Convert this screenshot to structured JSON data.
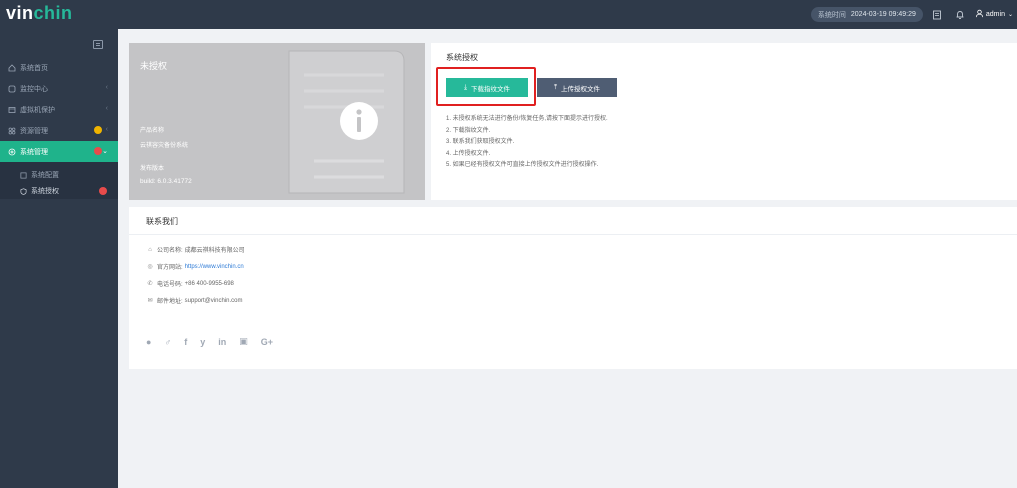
{
  "header": {
    "logo_prefix": "vin",
    "logo_suffix": "chin",
    "time_label": "系统时间",
    "time_value": "2024-03-19 09:49:29",
    "username": "admin"
  },
  "sidebar": {
    "items": [
      {
        "label": "系统首页",
        "icon": "home-icon"
      },
      {
        "label": "监控中心",
        "icon": "monitor-icon"
      },
      {
        "label": "虚拟机保护",
        "icon": "vm-icon"
      },
      {
        "label": "资源管理",
        "icon": "grid-icon"
      },
      {
        "label": "系统管理",
        "icon": "gear-icon"
      }
    ],
    "sub_items": [
      {
        "label": "系统配置",
        "icon": "config-icon"
      },
      {
        "label": "系统授权",
        "icon": "shield-icon"
      }
    ]
  },
  "license_card": {
    "status": "未授权",
    "product_label": "产品名称",
    "product_value": "云祺容灾备份系统",
    "version_label": "发布版本",
    "version_value": "build: 6.0.3.41772"
  },
  "auth_panel": {
    "title": "系统授权",
    "download_btn": "下载指纹文件",
    "upload_btn": "上传授权文件",
    "steps": [
      "1. 未授权系统无法进行备份/恢复任务,请按下面提示进行授权.",
      "2. 下载指纹文件.",
      "3. 联系我们获取授权文件.",
      "4. 上传授权文件.",
      "5. 如果已经有授权文件可直接上传授权文件进行授权操作."
    ]
  },
  "contact": {
    "title": "联系我们",
    "company_label": "公司名称:",
    "company_value": "成都云祺科技有限公司",
    "website_label": "官方网站:",
    "website_value": "https://www.vinchin.cn",
    "phone_label": "电话号码:",
    "phone_value": "+86 400-9955-698",
    "email_label": "邮件地址:",
    "email_value": "support@vinchin.com",
    "social": [
      {
        "icon": "wechat-icon",
        "glyph": "●"
      },
      {
        "icon": "weibo-icon",
        "glyph": "♂"
      },
      {
        "icon": "facebook-icon",
        "glyph": "f"
      },
      {
        "icon": "twitter-icon",
        "glyph": "y"
      },
      {
        "icon": "linkedin-icon",
        "glyph": "in"
      },
      {
        "icon": "bilibili-icon",
        "glyph": "▣"
      },
      {
        "icon": "googleplus-icon",
        "glyph": "G+"
      }
    ]
  },
  "colors": {
    "topbar": "#2f3a4a",
    "accent": "#26b99a",
    "highlight": "#e02020",
    "upload_button": "#4f5d73"
  }
}
